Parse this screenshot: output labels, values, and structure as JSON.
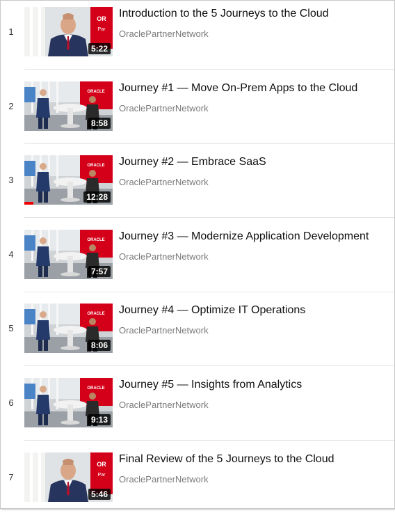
{
  "playlist": {
    "items": [
      {
        "index": "1",
        "title": "Introduction to the 5 Journeys to the Cloud",
        "channel": "OraclePartnerNetwork",
        "duration": "5:22",
        "scene": "solo",
        "watched": 0
      },
      {
        "index": "2",
        "title": "Journey #1 — Move On-Prem Apps to the Cloud",
        "channel": "OraclePartnerNetwork",
        "duration": "8:58",
        "scene": "studio",
        "watched": 0
      },
      {
        "index": "3",
        "title": "Journey #2 — Embrace SaaS",
        "channel": "OraclePartnerNetwork",
        "duration": "12:28",
        "scene": "studio",
        "watched": 0.1
      },
      {
        "index": "4",
        "title": "Journey #3 — Modernize Application Development",
        "channel": "OraclePartnerNetwork",
        "duration": "7:57",
        "scene": "studio",
        "watched": 0
      },
      {
        "index": "5",
        "title": "Journey #4 — Optimize IT Operations",
        "channel": "OraclePartnerNetwork",
        "duration": "8:06",
        "scene": "studio",
        "watched": 0
      },
      {
        "index": "6",
        "title": "Journey #5 — Insights from Analytics",
        "channel": "OraclePartnerNetwork",
        "duration": "9:13",
        "scene": "studio",
        "watched": 0
      },
      {
        "index": "7",
        "title": "Final Review of the 5 Journeys to the Cloud",
        "channel": "OraclePartnerNetwork",
        "duration": "5:46",
        "scene": "solo",
        "watched": 0
      }
    ]
  },
  "colors": {
    "brand_red": "#d4001a",
    "progress_red": "#ee0000",
    "channel_gray": "#7a7a7a"
  }
}
